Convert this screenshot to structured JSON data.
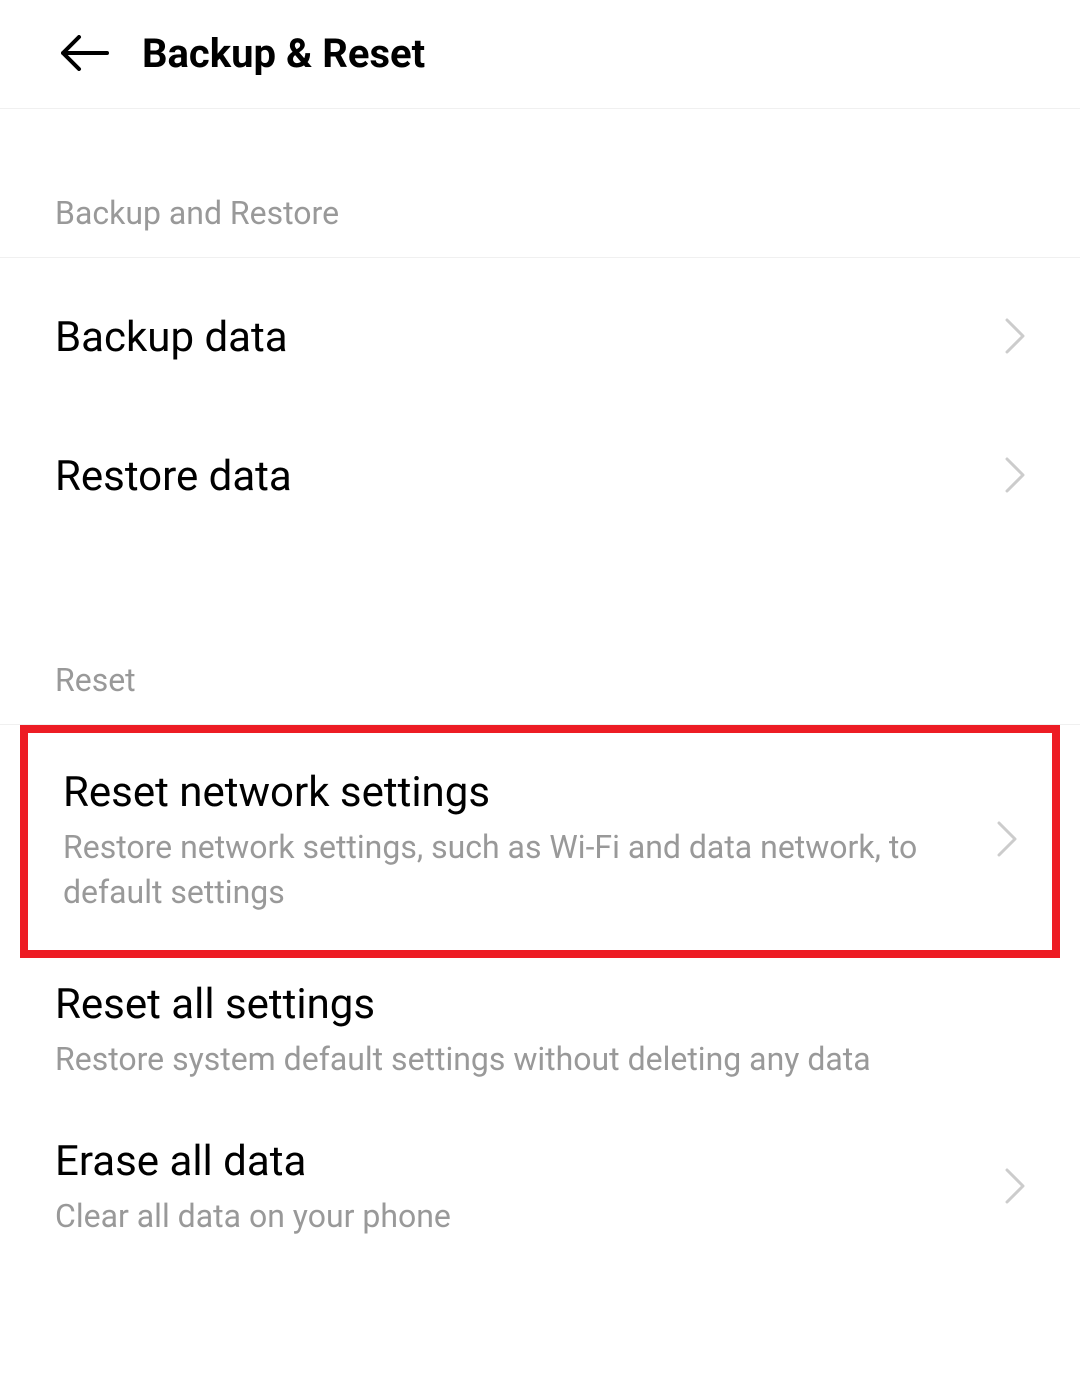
{
  "header": {
    "title": "Backup & Reset"
  },
  "sections": {
    "backup_restore": {
      "header": "Backup and Restore",
      "items": {
        "backup": {
          "title": "Backup data"
        },
        "restore": {
          "title": "Restore data"
        }
      }
    },
    "reset": {
      "header": "Reset",
      "items": {
        "network": {
          "title": "Reset network settings",
          "subtitle": "Restore network settings, such as Wi-Fi and data network, to default settings"
        },
        "all_settings": {
          "title": "Reset all settings",
          "subtitle": "Restore system default settings without deleting any data"
        },
        "erase": {
          "title": "Erase all data",
          "subtitle": "Clear all data on your phone"
        }
      }
    }
  }
}
